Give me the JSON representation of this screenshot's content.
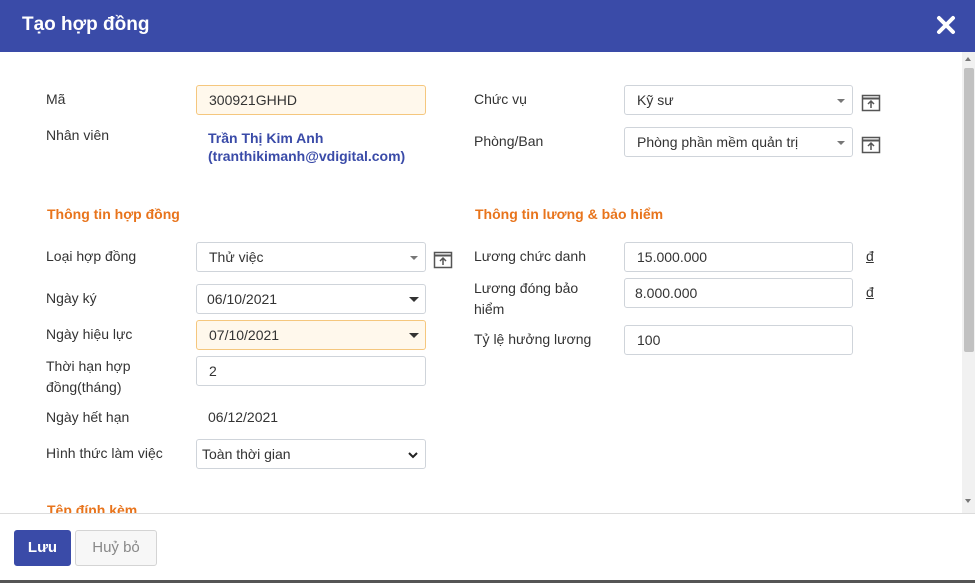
{
  "dialog": {
    "title": "Tạo hợp đồng"
  },
  "left": {
    "ma_label": "Mã",
    "ma_value": "300921GHHD",
    "nhan_vien_label": "Nhân viên",
    "nhan_vien_name": "Trần Thị Kim Anh",
    "nhan_vien_email": "(tranthikimanh@vdigital.com)"
  },
  "right": {
    "chuc_vu_label": "Chức vụ",
    "chuc_vu_value": "Kỹ sư",
    "phong_ban_label": "Phòng/Ban",
    "phong_ban_value": "Phòng phần mềm quản trị"
  },
  "contract": {
    "section_title": "Thông tin hợp đồng",
    "loai_label": "Loại hợp đồng",
    "loai_value": "Thử việc",
    "ngay_ky_label": "Ngày ký",
    "ngay_ky_value": "06/10/2021",
    "ngay_hieu_luc_label": "Ngày hiệu lực",
    "ngay_hieu_luc_value": "07/10/2021",
    "thoi_han_label_1": "Thời hạn hợp",
    "thoi_han_label_2": "đồng(tháng)",
    "thoi_han_value": "2",
    "ngay_het_han_label": "Ngày hết hạn",
    "ngay_het_han_value": "06/12/2021",
    "hinh_thuc_label": "Hình thức làm việc",
    "hinh_thuc_value": "Toàn thời gian",
    "attachment_section": "Tệp đính kèm"
  },
  "salary": {
    "section_title": "Thông tin lương & bảo hiểm",
    "luong_chuc_danh_label": "Lương chức danh",
    "luong_chuc_danh_value": "15.000.000",
    "luong_bh_label_1": "Lương đóng bảo",
    "luong_bh_label_2": "hiểm",
    "luong_bh_value": "8.000.000",
    "ty_le_label": "Tỷ lệ hưởng lương",
    "ty_le_value": "100",
    "currency_symbol": "đ"
  },
  "footer": {
    "save_label": "Lưu",
    "cancel_label": "Huỷ bỏ"
  },
  "colors": {
    "header": "#3a4ba8",
    "section": "#e8741c",
    "link": "#3a4ba8",
    "highlight_bg": "#fff8ec"
  }
}
